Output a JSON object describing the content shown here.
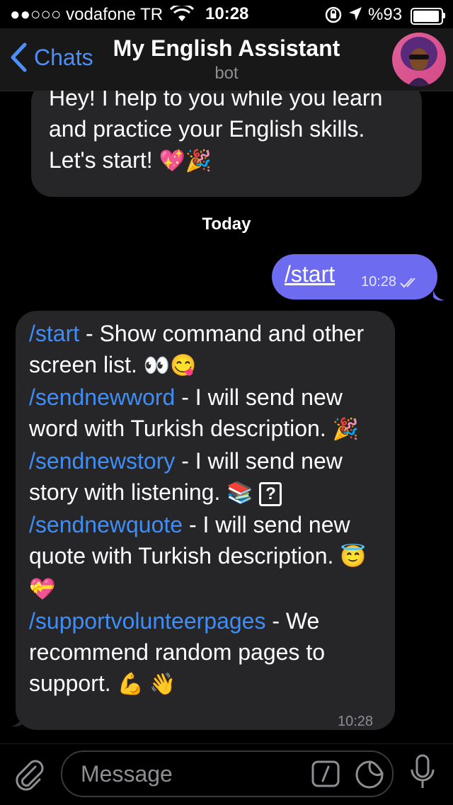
{
  "status_bar": {
    "carrier": "●●○○○ vodafone TR",
    "time": "10:28",
    "battery": "%93"
  },
  "nav": {
    "back_label": "Chats",
    "title": "My English Assistant",
    "subtitle": "bot"
  },
  "messages": {
    "intro": {
      "text": "Hey! I help to you while you learn and practice your English skills. Let's start!",
      "emojis": "💖🎉"
    },
    "date_divider": "Today",
    "outgoing": {
      "text": "/start",
      "time": "10:28"
    },
    "commands": {
      "time": "10:28",
      "items": [
        {
          "cmd": "/start",
          "desc": " - Show command and other screen list. ",
          "emoji": "👀😋"
        },
        {
          "cmd": "/sendnewword",
          "desc": " - I will send new word with Turkish description. ",
          "emoji": "🎉"
        },
        {
          "cmd": "/sendnewstory",
          "desc": " - I will send new story with listening. ",
          "emoji": "📚",
          "extra": "?"
        },
        {
          "cmd": "/sendnewquote",
          "desc": " - I will send new quote with Turkish description. ",
          "emoji": "😇💝"
        },
        {
          "cmd": "/supportvolunteerpages",
          "desc": " - We recommend random pages to support. ",
          "emoji": "💪 👋"
        }
      ]
    }
  },
  "input": {
    "placeholder": "Message"
  },
  "colors": {
    "accent": "#4d8ff6",
    "outgoing_bubble": "#6d6cf0",
    "incoming_bubble": "#262628"
  }
}
